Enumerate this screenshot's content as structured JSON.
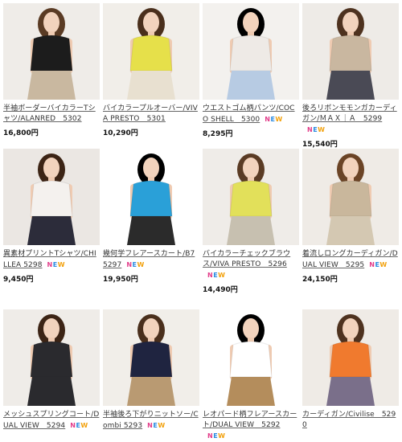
{
  "badge": [
    "N",
    "E",
    "W"
  ],
  "products": [
    {
      "name": "半袖ボーダーバイカラーTシャツ/ALANRED　5302",
      "new": false,
      "price": "16,800円",
      "top": "#1c1c1c",
      "bottom": "#c9b8a0",
      "bg": "#efece8",
      "hair": "#5a3b24"
    },
    {
      "name": "バイカラープルオーバー/VIVA PRESTO　5301",
      "new": false,
      "price": "10,290円",
      "top": "#e6e04a",
      "bottom": "#e8e0d0",
      "bg": "#f1eee9",
      "hair": "#4a2f1c"
    },
    {
      "name": "ウエストゴム柄パンツ/COCO SHELL　5300",
      "new": true,
      "price": "8,295円",
      "top": "#eeeae6",
      "bottom": "#b7cbe3",
      "bg": "#f3f1ee",
      "hair": "#000000"
    },
    {
      "name": "後ろリボンモモンガカーディガン/ＭＡＸ｜Ａ　5299",
      "new": true,
      "price": "15,540円",
      "top": "#c9b7a0",
      "bottom": "#4a4a55",
      "bg": "#eeebe7",
      "hair": "#4e321f"
    },
    {
      "name": "異素材プリントTシャツ/CHILLEA 5298",
      "new": true,
      "price": "9,450円",
      "top": "#f4f1ee",
      "bottom": "#2c2c3a",
      "bg": "#ebe7e3",
      "hair": "#3c2415"
    },
    {
      "name": "幾何学フレアースカート/B7 5297",
      "new": true,
      "price": "19,950円",
      "top": "#2aa0d8",
      "bottom": "#2b2b2b",
      "bg": "#ffffff",
      "hair": "#000000"
    },
    {
      "name": "バイカラーチェックブラウス/VIVA PRESTO　5296",
      "new": true,
      "price": "14,490円",
      "top": "#e2e05a",
      "bottom": "#c7c0b0",
      "bg": "#efece8",
      "hair": "#5a3b24"
    },
    {
      "name": "着流しロングカーディガン/DUAL VIEW　5295",
      "new": true,
      "price": "24,150円",
      "top": "#c9b79c",
      "bottom": "#d4c8b2",
      "bg": "#efebe6",
      "hair": "#6b4426"
    },
    {
      "name": "メッシュスプリングコート/DUAL VIEW　5294",
      "new": true,
      "price": "",
      "top": "#2a2a2e",
      "bottom": "#2a2a2e",
      "bg": "#efece8",
      "hair": "#3c2415"
    },
    {
      "name": "半袖後ろ下がりニットソー/Combi 5293",
      "new": true,
      "price": "",
      "top": "#1f2440",
      "bottom": "#b99a72",
      "bg": "#f1eee9",
      "hair": "#4a2f1c"
    },
    {
      "name": "レオパード柄フレアースカート/DUAL VIEW　5292",
      "new": true,
      "price": "",
      "top": "#ffffff",
      "bottom": "#b48d5c",
      "bg": "#ffffff",
      "hair": "#000000"
    },
    {
      "name": "カーディガン/Civilise　5290",
      "new": false,
      "price": "",
      "top": "#f07a2e",
      "bottom": "#7a6f8a",
      "bg": "#efebe6",
      "hair": "#4e321f"
    }
  ]
}
